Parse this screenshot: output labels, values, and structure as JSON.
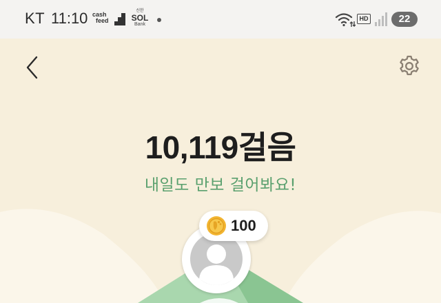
{
  "status_bar": {
    "carrier": "KT",
    "time": "11:10",
    "cashfeed_line1": "cash",
    "cashfeed_line2": "feed",
    "sol_top": "신한",
    "sol_logo": "SOL",
    "sol_bottom": "Bank",
    "hd_label": "HD",
    "battery_level": "22",
    "icons": [
      "cashfeed-icon",
      "stair-icon",
      "sol-bank-icon",
      "notification-dot-icon",
      "wifi-icon",
      "hd-icon",
      "signal-icon",
      "battery-icon"
    ]
  },
  "header": {
    "back_icon": "chevron-left-icon",
    "settings_icon": "gear-icon"
  },
  "main": {
    "step_count": "10,119걸음",
    "subtitle": "내일도 만보 걸어봐요!",
    "coin_reward": "100",
    "colors": {
      "background": "#f7efdc",
      "accent_green": "#5aa06e",
      "coin_gold": "#f2b531"
    }
  }
}
